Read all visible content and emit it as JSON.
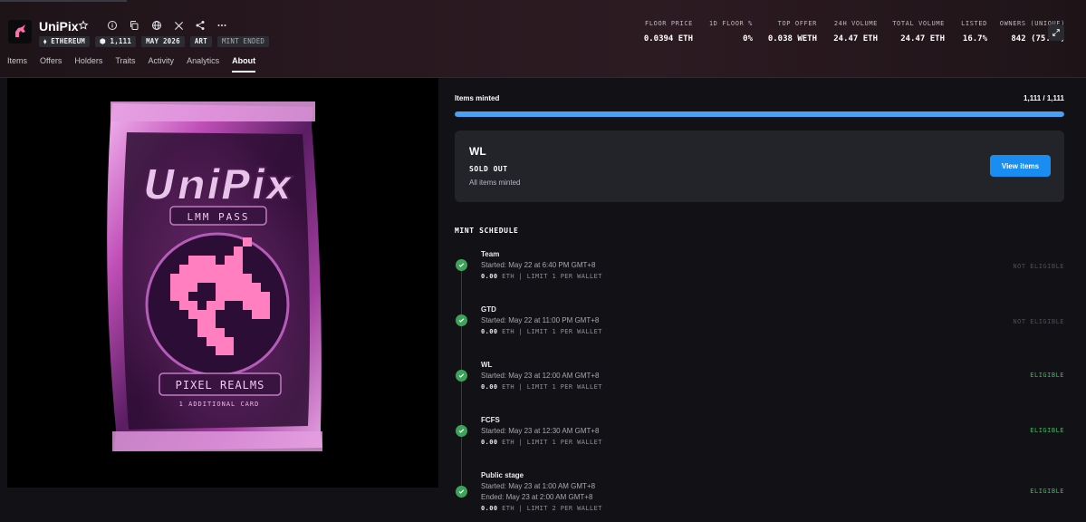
{
  "collection": {
    "name": "UniPix",
    "badges": [
      {
        "label": "ETHEREUM",
        "icon": "ethereum-icon"
      },
      {
        "label": "1,111",
        "icon": "items-icon"
      },
      {
        "label": "MAY 2026"
      },
      {
        "label": "ART"
      },
      {
        "label": "MINT ENDED"
      }
    ]
  },
  "stats": [
    {
      "label": "FLOOR PRICE",
      "value": "0.0394 ETH"
    },
    {
      "label": "1D FLOOR %",
      "value": "0%"
    },
    {
      "label": "TOP OFFER",
      "value": "0.038 WETH"
    },
    {
      "label": "24H VOLUME",
      "value": "24.47 ETH"
    },
    {
      "label": "TOTAL VOLUME",
      "value": "24.47 ETH"
    },
    {
      "label": "LISTED",
      "value": "16.7%"
    },
    {
      "label": "OWNERS (UNIQUE)",
      "value": "842 (75.8%)"
    }
  ],
  "tabs": [
    "Items",
    "Offers",
    "Holders",
    "Traits",
    "Activity",
    "Analytics",
    "About"
  ],
  "active_tab": "About",
  "artwork": {
    "title": "UniPix",
    "subtitle": "LMM PASS",
    "banner": "PIXEL REALMS",
    "footer": "1 ADDITIONAL CARD"
  },
  "minted": {
    "label": "Items minted",
    "count": "1,111 / 1,111",
    "fraction": 1.0
  },
  "current_stage": {
    "name": "WL",
    "status": "SOLD OUT",
    "sub": "All items minted",
    "button": "View items"
  },
  "schedule": {
    "title": "MINT SCHEDULE",
    "stages": [
      {
        "name": "Team",
        "line1": "Started: May 22 at 6:40 PM GMT+8",
        "line2": "",
        "price": "0.00",
        "unit": "ETH | LIMIT 1 PER WALLET",
        "eligibility": "NOT ELIGIBLE"
      },
      {
        "name": "GTD",
        "line1": "Started: May 22 at 11:00 PM GMT+8",
        "line2": "",
        "price": "0.00",
        "unit": "ETH | LIMIT 1 PER WALLET",
        "eligibility": "NOT ELIGIBLE"
      },
      {
        "name": "WL",
        "line1": "Started: May 23 at 12:00 AM GMT+8",
        "line2": "",
        "price": "0.00",
        "unit": "ETH | LIMIT 1 PER WALLET",
        "eligibility": "ELIGIBLE"
      },
      {
        "name": "FCFS",
        "line1": "Started: May 23 at 12:30 AM GMT+8",
        "line2": "",
        "price": "0.00",
        "unit": "ETH | LIMIT 1 PER WALLET",
        "eligibility": "ELIGIBLE"
      },
      {
        "name": "Public stage",
        "line1": "Started: May 23 at 1:00 AM GMT+8",
        "line2": "Ended: May 23 at 2:00 AM GMT+8",
        "price": "0.00",
        "unit": "ETH | LIMIT 2 PER WALLET",
        "eligibility": "ELIGIBLE"
      }
    ]
  },
  "colors": {
    "accent": "#1a8df2",
    "progress": "#4aa0f2",
    "eligible": "#46b06a",
    "not_eligible": "#4c4c54",
    "check": "#3ea35a"
  }
}
